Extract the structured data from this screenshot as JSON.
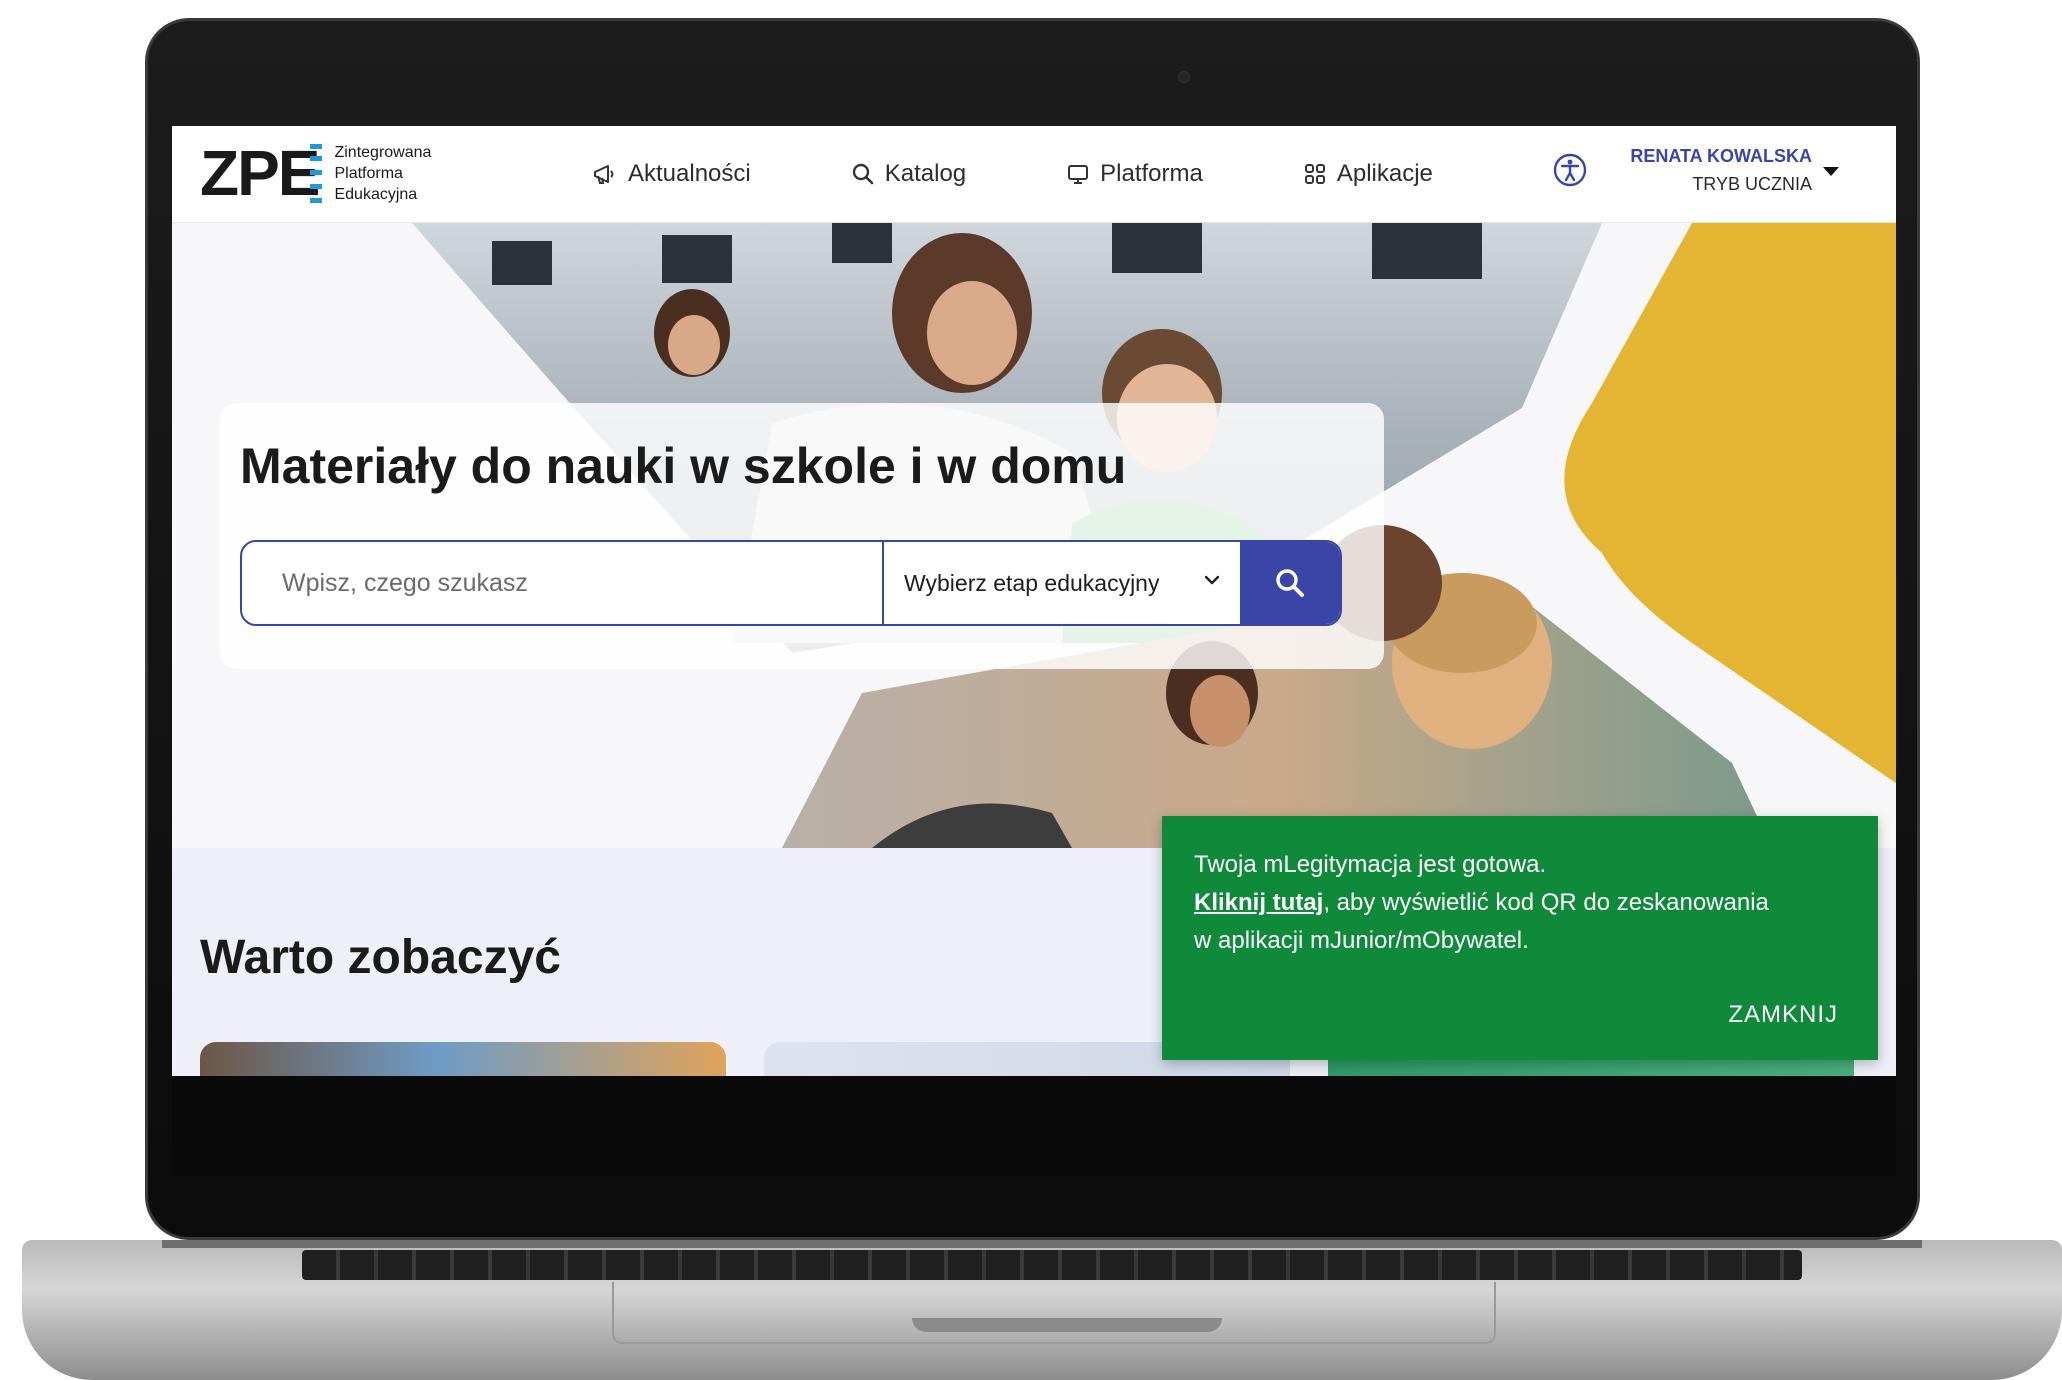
{
  "logo": {
    "mark": "ZPE",
    "line1": "Zintegrowana",
    "line2": "Platforma",
    "line3": "Edukacyjna"
  },
  "nav": {
    "items": [
      {
        "label": "Aktualności",
        "icon": "megaphone-icon"
      },
      {
        "label": "Katalog",
        "icon": "search-icon"
      },
      {
        "label": "Platforma",
        "icon": "monitor-icon"
      },
      {
        "label": "Aplikacje",
        "icon": "apps-grid-icon"
      }
    ]
  },
  "user": {
    "name": "RENATA KOWALSKA",
    "mode": "TRYB UCZNIA"
  },
  "hero": {
    "title": "Materiały do nauki w szkole i w domu",
    "search_placeholder": "Wpisz, czego szukasz",
    "stage_select_value": "Wybierz etap edukacyjny"
  },
  "section": {
    "title": "Warto zobaczyć"
  },
  "toast": {
    "line1": "Twoja mLegitymacja jest gotowa.",
    "link": "Kliknij tutaj",
    "line2_rest": ", aby wyświetlić kod QR do zeskanowania",
    "line3": "w aplikacji mJunior/mObywatel.",
    "close_label": "ZAMKNIJ"
  },
  "colors": {
    "accent": "#3a46a7",
    "toast_bg": "#0f8a3b",
    "hero_yellow": "#e4b533",
    "section_bg": "#eeeff7"
  }
}
